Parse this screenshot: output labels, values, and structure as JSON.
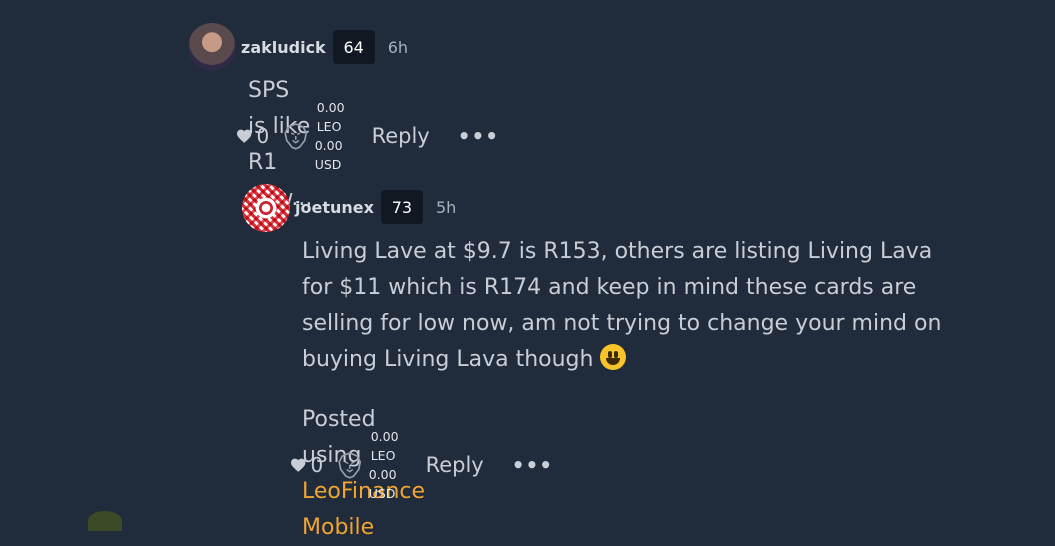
{
  "comments": [
    {
      "username": "zakludick",
      "reputation": "64",
      "time": "6h",
      "body": "SPS is like R1 now...",
      "likes": "0",
      "payout_leo": "0.00 LEO",
      "payout_usd": "0.00 USD",
      "reply_label": "Reply",
      "more_label": "•••"
    },
    {
      "username": "joetunex",
      "reputation": "73",
      "time": "5h",
      "body": "Living Lave at $9.7 is R153, others are listing Living Lava for $11 which is R174 and keep in mind these cards are selling for low now, am not trying to change your mind on buying Living Lava though",
      "posted_prefix": "Posted using ",
      "posted_link": "LeoFinance Mobile",
      "likes": "0",
      "payout_leo": "0.00 LEO",
      "payout_usd": "0.00 USD",
      "reply_label": "Reply",
      "more_label": "•••"
    }
  ],
  "colors": {
    "background": "#202b3b",
    "link": "#f0a531",
    "badge": "#111821"
  },
  "icons": [
    "heart-icon",
    "leo-lion-icon",
    "more-icon",
    "grinning-emoji"
  ]
}
